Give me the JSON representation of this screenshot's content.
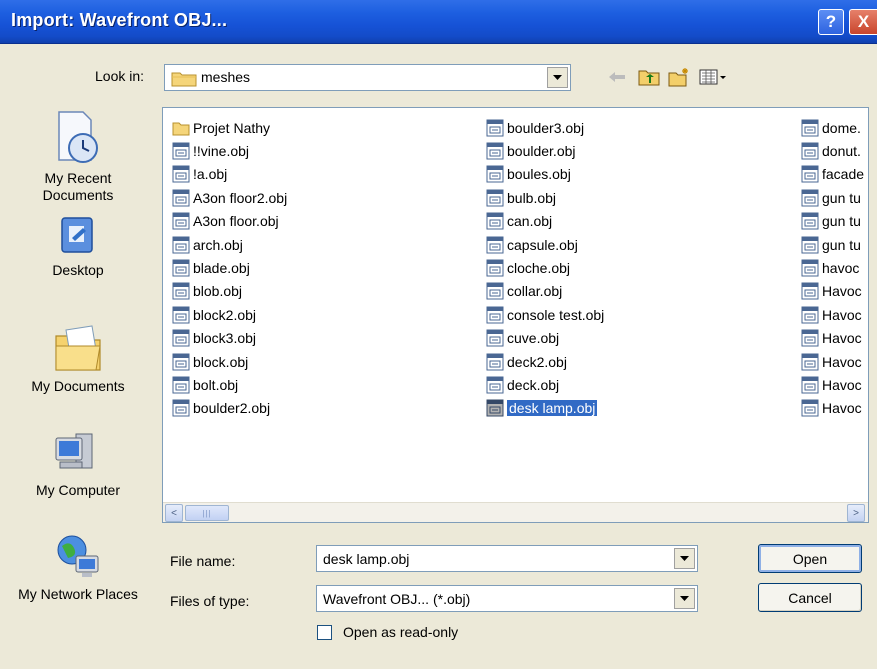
{
  "window": {
    "title": "Import: Wavefront OBJ...",
    "help_label": "?",
    "close_label": "X"
  },
  "lookin": {
    "label": "Look in:",
    "value": "meshes"
  },
  "places": [
    {
      "label": "My Recent Documents",
      "icon": "recent-documents-icon"
    },
    {
      "label": "Desktop",
      "icon": "desktop-icon"
    },
    {
      "label": "My Documents",
      "icon": "my-documents-icon"
    },
    {
      "label": "My Computer",
      "icon": "my-computer-icon"
    },
    {
      "label": "My Network Places",
      "icon": "network-places-icon"
    }
  ],
  "files": {
    "columns": [
      [
        {
          "name": "Projet Nathy",
          "type": "folder"
        },
        {
          "name": "!!vine.obj",
          "type": "obj"
        },
        {
          "name": "!a.obj",
          "type": "obj"
        },
        {
          "name": "A3on floor2.obj",
          "type": "obj"
        },
        {
          "name": "A3on floor.obj",
          "type": "obj"
        },
        {
          "name": "arch.obj",
          "type": "obj"
        },
        {
          "name": "blade.obj",
          "type": "obj"
        },
        {
          "name": "blob.obj",
          "type": "obj"
        },
        {
          "name": "block2.obj",
          "type": "obj"
        },
        {
          "name": "block3.obj",
          "type": "obj"
        },
        {
          "name": "block.obj",
          "type": "obj"
        },
        {
          "name": "bolt.obj",
          "type": "obj"
        },
        {
          "name": "boulder2.obj",
          "type": "obj"
        }
      ],
      [
        {
          "name": "boulder3.obj",
          "type": "obj"
        },
        {
          "name": "boulder.obj",
          "type": "obj"
        },
        {
          "name": "boules.obj",
          "type": "obj"
        },
        {
          "name": "bulb.obj",
          "type": "obj"
        },
        {
          "name": "can.obj",
          "type": "obj"
        },
        {
          "name": "capsule.obj",
          "type": "obj"
        },
        {
          "name": "cloche.obj",
          "type": "obj"
        },
        {
          "name": "collar.obj",
          "type": "obj"
        },
        {
          "name": "console test.obj",
          "type": "obj"
        },
        {
          "name": "cuve.obj",
          "type": "obj"
        },
        {
          "name": "deck2.obj",
          "type": "obj"
        },
        {
          "name": "deck.obj",
          "type": "obj"
        },
        {
          "name": "desk lamp.obj",
          "type": "obj",
          "selected": true
        }
      ],
      [
        {
          "name": "dome.",
          "type": "obj"
        },
        {
          "name": "donut.",
          "type": "obj"
        },
        {
          "name": "facade",
          "type": "obj"
        },
        {
          "name": "gun tu",
          "type": "obj"
        },
        {
          "name": "gun tu",
          "type": "obj"
        },
        {
          "name": "gun tu",
          "type": "obj"
        },
        {
          "name": "havoc",
          "type": "obj"
        },
        {
          "name": "Havoc",
          "type": "obj"
        },
        {
          "name": "Havoc",
          "type": "obj"
        },
        {
          "name": "Havoc",
          "type": "obj"
        },
        {
          "name": "Havoc",
          "type": "obj"
        },
        {
          "name": "Havoc",
          "type": "obj"
        },
        {
          "name": "Havoc",
          "type": "obj"
        }
      ]
    ]
  },
  "scroll": {
    "left_glyph": "<",
    "right_glyph": ">",
    "thumb_grip": "|||"
  },
  "form": {
    "filename_label": "File name:",
    "filename_value": "desk lamp.obj",
    "filetype_label": "Files of type:",
    "filetype_value": "Wavefront OBJ... (*.obj)",
    "readonly_label": "Open as read-only",
    "readonly_checked": false,
    "open_label": "Open",
    "cancel_label": "Cancel"
  },
  "colors": {
    "titlebar": "#1652d6",
    "selection": "#316ac5",
    "dialog_bg": "#ece9d8"
  }
}
